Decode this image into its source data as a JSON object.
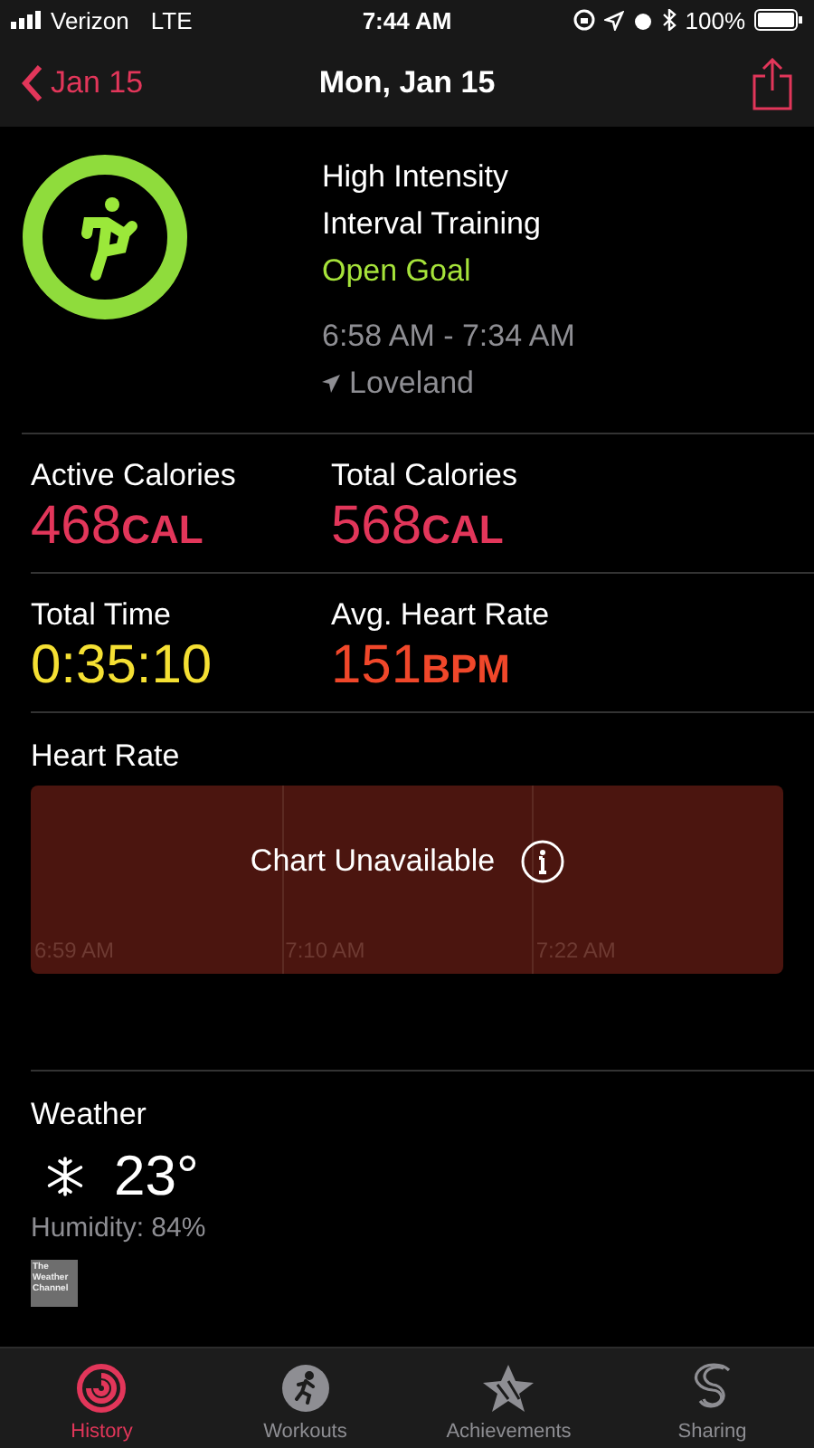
{
  "status_bar": {
    "carrier": "Verizon",
    "network": "LTE",
    "time": "7:44 AM",
    "battery": "100%"
  },
  "nav": {
    "back_label": "Jan 15",
    "title": "Mon, Jan 15"
  },
  "workout": {
    "name_lines": [
      "High Intensity",
      "Interval Training"
    ],
    "goal": "Open Goal",
    "time_range": "6:58 AM - 7:34 AM",
    "location": "Loveland"
  },
  "metrics": [
    [
      {
        "label": "Active Calories",
        "value": "468",
        "unit": "CAL",
        "color": "#e2365a"
      },
      {
        "label": "Total Calories",
        "value": "568",
        "unit": "CAL",
        "color": "#e2365a"
      }
    ],
    [
      {
        "label": "Total Time",
        "value": "0:35:10",
        "color": "#f5e033"
      },
      {
        "label": "Avg. Heart Rate",
        "value": "151",
        "unit": "BPM",
        "color": "#f0472a"
      }
    ]
  ],
  "heart_rate": {
    "title": "Heart Rate",
    "message": "Chart Unavailable",
    "time_labels": [
      "6:59 AM",
      "7:10 AM",
      "7:22 AM"
    ]
  },
  "weather": {
    "title": "Weather",
    "temperature": "23°",
    "humidity": "Humidity: 84%",
    "source_logo": "The Weather Channel"
  },
  "tab_bar": [
    {
      "label": "History",
      "kind": "history",
      "selected": true
    },
    {
      "label": "Workouts",
      "kind": "workouts",
      "selected": false
    },
    {
      "label": "Achievements",
      "kind": "achievements",
      "selected": false
    },
    {
      "label": "Sharing",
      "kind": "sharing",
      "selected": false
    }
  ]
}
